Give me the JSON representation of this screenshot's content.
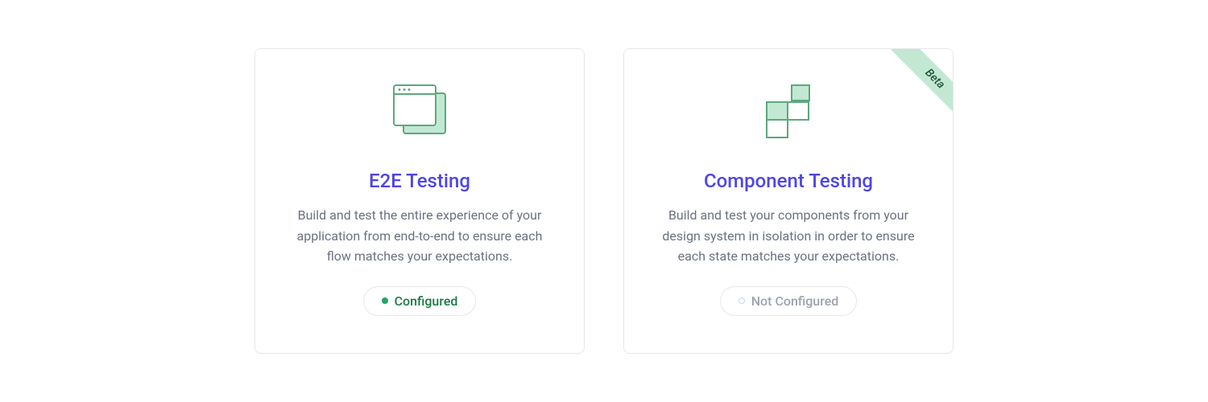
{
  "cards": {
    "e2e": {
      "title": "E2E Testing",
      "description": "Build and test the entire experience of your application from end-to-end to ensure each flow matches your expectations.",
      "status_label": "Configured"
    },
    "component": {
      "title": "Component Testing",
      "description": "Build and test your components from your design system in isolation in order to ensure each state matches your expectations.",
      "status_label": "Not Configured",
      "badge": "Beta"
    }
  },
  "colors": {
    "accent": "#4f46e5",
    "configured": "#197a43",
    "not_configured": "#9ca3af",
    "icon_stroke": "#5ca87c",
    "icon_fill": "#c2e8d4"
  }
}
